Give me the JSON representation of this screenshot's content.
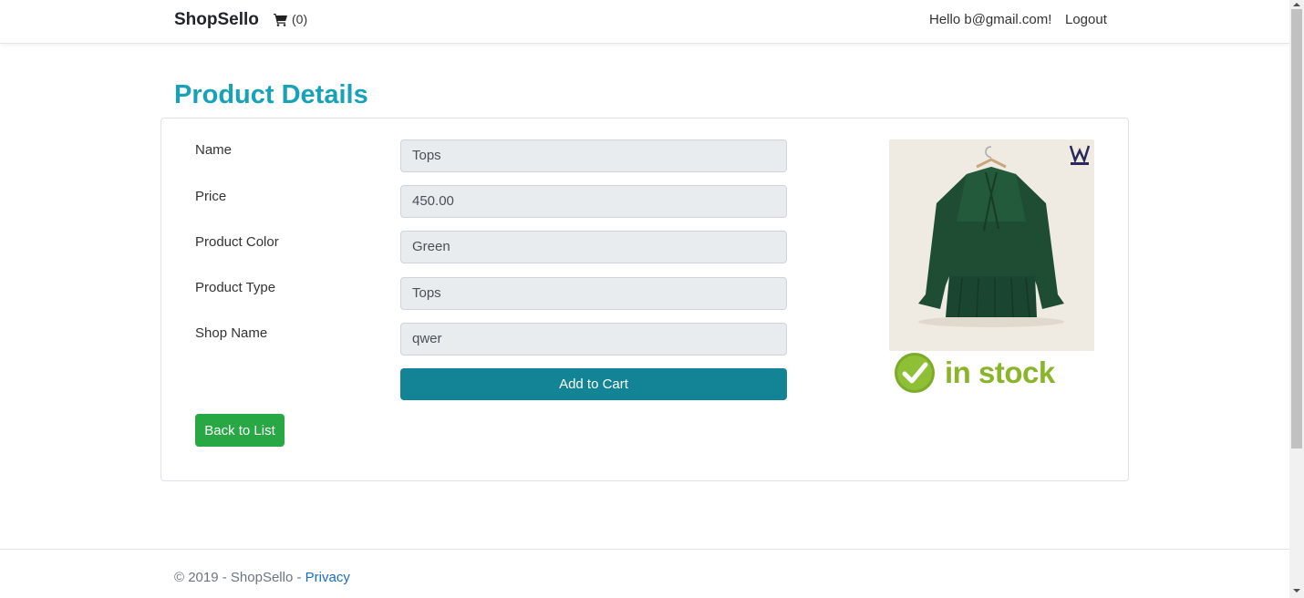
{
  "nav": {
    "brand": "ShopSello",
    "cart_count": "(0)",
    "greeting": "Hello b@gmail.com!",
    "logout": "Logout"
  },
  "page": {
    "title": "Product Details"
  },
  "product": {
    "fields": [
      {
        "label": "Name",
        "value": "Tops"
      },
      {
        "label": "Price",
        "value": "450.00"
      },
      {
        "label": "Product Color",
        "value": "Green"
      },
      {
        "label": "Product Type",
        "value": "Tops"
      },
      {
        "label": "Shop Name",
        "value": "qwer"
      }
    ],
    "add_to_cart": "Add to Cart",
    "back_to_list": "Back to List",
    "stock_status": "in stock",
    "brand_mark": "WEAR-BUY"
  },
  "footer": {
    "copyright": "© 2019 - ShopSello - ",
    "privacy": "Privacy"
  },
  "colors": {
    "title": "#17a2b8",
    "add_to_cart": "#138496",
    "back_button": "#28a745",
    "in_stock": "#8ab52b",
    "link": "#1b6ec2"
  },
  "icons": [
    "shopping-cart-icon",
    "check-circle-icon",
    "brand-logo-icon"
  ]
}
